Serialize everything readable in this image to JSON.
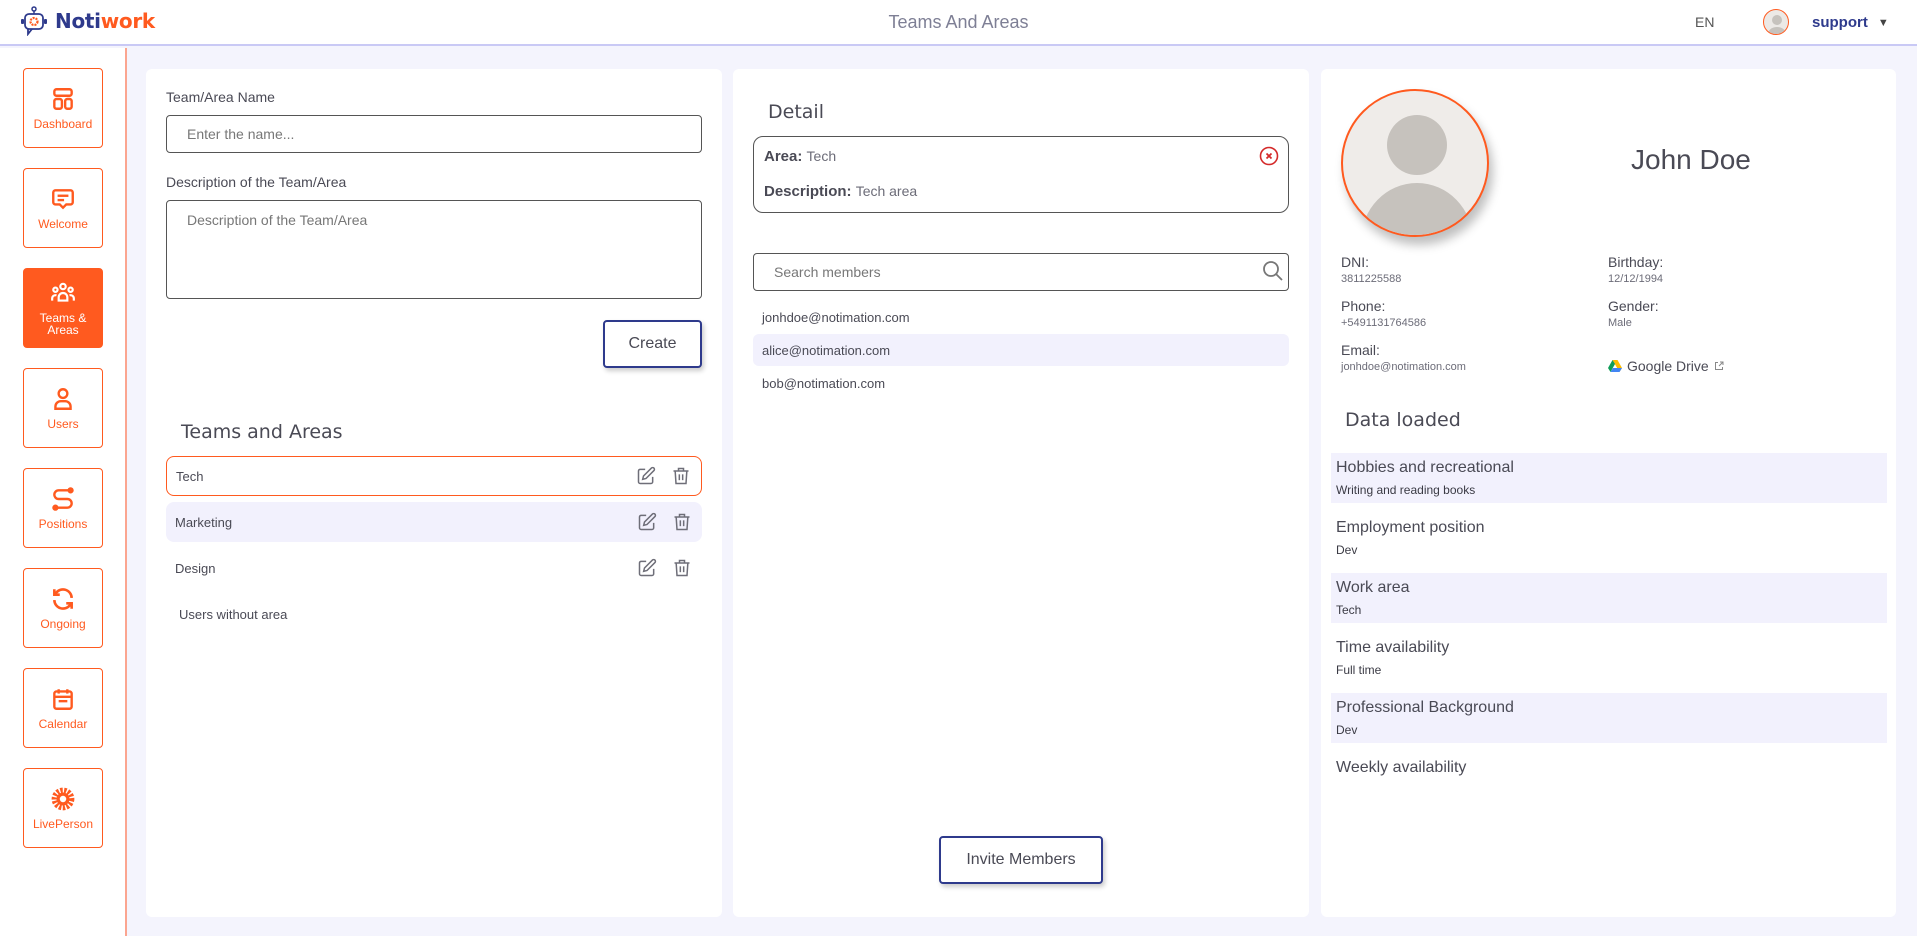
{
  "header": {
    "brand_part1": "Noti",
    "brand_part2": "work",
    "title": "Teams And Areas",
    "language": "EN",
    "username": "support",
    "caret": "▼"
  },
  "sidebar": {
    "items": [
      {
        "label": "Dashboard",
        "icon": "layout-icon",
        "active": false
      },
      {
        "label": "Welcome",
        "icon": "message-icon",
        "active": false
      },
      {
        "label": "Teams & Areas",
        "icon": "team-icon",
        "active": true
      },
      {
        "label": "Users",
        "icon": "user-icon",
        "active": false
      },
      {
        "label": "Positions",
        "icon": "route-icon",
        "active": false
      },
      {
        "label": "Ongoing",
        "icon": "refresh-icon",
        "active": false
      },
      {
        "label": "Calendar",
        "icon": "calendar-icon",
        "active": false
      },
      {
        "label": "LivePerson",
        "icon": "gear-icon",
        "active": false
      }
    ]
  },
  "form": {
    "name_label": "Team/Area Name",
    "name_placeholder": "Enter the name...",
    "name_value": "",
    "desc_label": "Description of the Team/Area",
    "desc_placeholder": "Description of the Team/Area",
    "desc_value": "",
    "create_label": "Create"
  },
  "teams": {
    "title": "Teams and Areas",
    "items": [
      {
        "name": "Tech",
        "selected": true
      },
      {
        "name": "Marketing",
        "selected": false
      },
      {
        "name": "Design",
        "selected": false
      }
    ],
    "without_area_label": "Users without area"
  },
  "detail": {
    "title": "Detail",
    "area_label": "Area:",
    "area_value": "Tech",
    "description_label": "Description:",
    "description_value": "Tech area",
    "search_placeholder": "Search members",
    "search_value": "",
    "members": [
      "jonhdoe@notimation.com",
      "alice@notimation.com",
      "bob@notimation.com"
    ],
    "invite_label": "Invite Members"
  },
  "profile": {
    "name": "John Doe",
    "fields": {
      "dni": {
        "label": "DNI:",
        "value": "3811225588"
      },
      "birthday": {
        "label": "Birthday:",
        "value": "12/12/1994"
      },
      "phone": {
        "label": "Phone:",
        "value": "+5491131764586"
      },
      "gender": {
        "label": "Gender:",
        "value": "Male"
      },
      "email": {
        "label": "Email:",
        "value": "jonhdoe@notimation.com"
      }
    },
    "drive_label": "Google Drive",
    "data_title": "Data loaded",
    "data": [
      {
        "label": "Hobbies and recreational",
        "value": "Writing and reading books"
      },
      {
        "label": "Employment position",
        "value": "Dev"
      },
      {
        "label": "Work area",
        "value": "Tech"
      },
      {
        "label": "Time availability",
        "value": "Full time"
      },
      {
        "label": "Professional Background",
        "value": "Dev"
      },
      {
        "label": "Weekly availability",
        "value": ""
      }
    ]
  },
  "colors": {
    "accent": "#ff5a1f",
    "brand": "#2e3a8c",
    "background": "#f4f4fd",
    "row_alt": "#f2f1fd",
    "danger": "#d42a2a"
  }
}
